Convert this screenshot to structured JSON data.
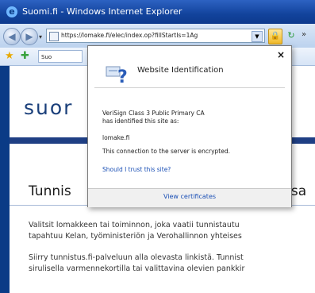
{
  "window": {
    "title": "Suomi.fi - Windows Internet Explorer"
  },
  "toolbar": {
    "address": "https://lomake.fi/elec/index.op?fillStartIs=1Ag"
  },
  "favorites": {
    "tab_label": "Suo"
  },
  "page": {
    "logo_text": "suor",
    "heading_left": "Tunnis",
    "heading_right": "ssa",
    "paragraph1_line1": "Valitsit lomakkeen tai toiminnon, joka vaatii tunnistautu",
    "paragraph1_line2": "tapahtuu Kelan, työministeriön ja Verohallinnon yhteises",
    "paragraph2_line1": "Siirry tunnistus.fi-palveluun alla olevasta linkistä. Tunnist",
    "paragraph2_line2": "sirulisella varmennekortilla tai valittavina olevien pankkir"
  },
  "popup": {
    "close": "×",
    "title": "Website Identification",
    "issuer_line1": "VeriSign Class 3 Public Primary CA",
    "issuer_line2": "has identified this site as:",
    "site": "lomake.fi",
    "encrypted": "This connection to the server is encrypted.",
    "trust_link": "Should I trust this site?",
    "view_certificates": "View certificates"
  },
  "colors": {
    "frame": "#0a3b86",
    "brand_blue": "#1f3f84",
    "link": "#1a4fb5"
  },
  "icons": [
    "ie-logo-icon",
    "back-icon",
    "forward-icon",
    "page-icon",
    "lock-icon",
    "refresh-icon",
    "favorites-star-icon",
    "add-favorite-icon",
    "identification-question-icon"
  ]
}
